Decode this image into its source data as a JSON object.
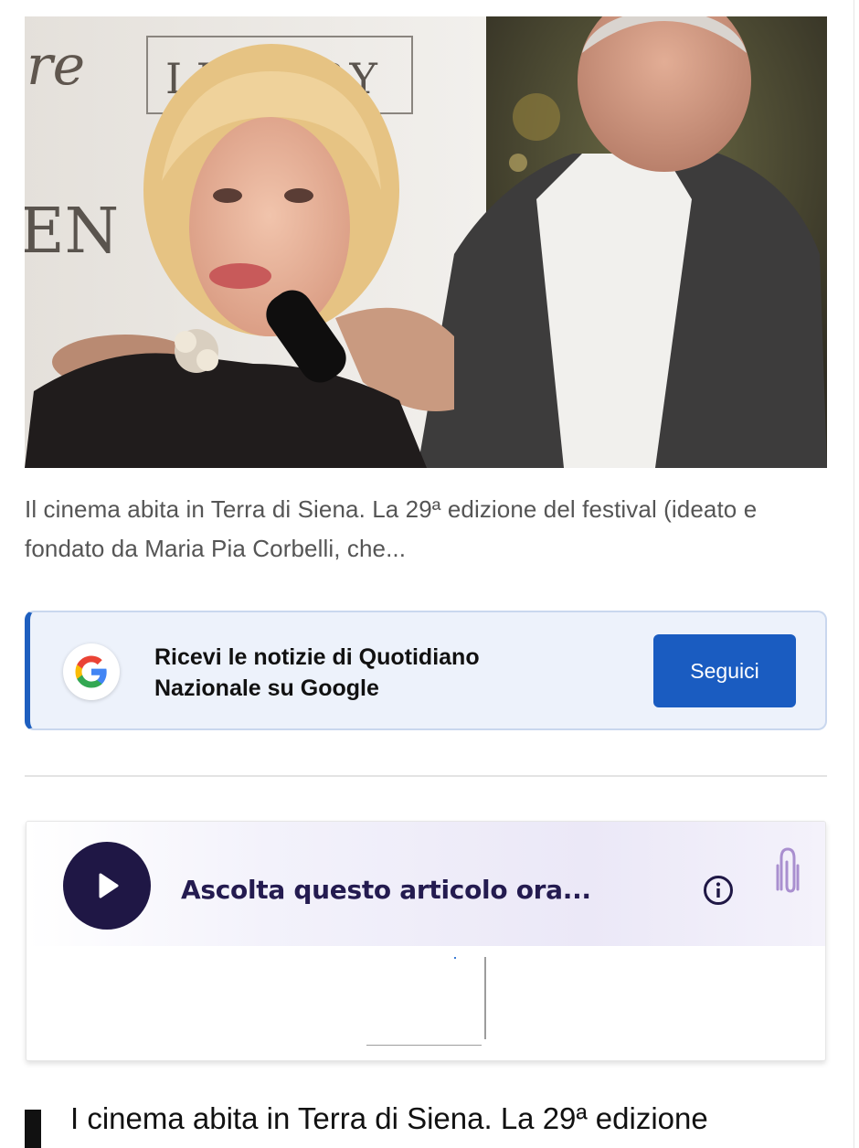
{
  "hero": {
    "image_alt": "Photo of a blonde woman speaking into a microphone next to a man in a grey jacket",
    "backdrop_text_1": "re",
    "backdrop_text_2": "LUXURY",
    "backdrop_text_3": "EN"
  },
  "caption": {
    "text": "Il cinema abita in Terra di Siena. La 29ª edizione del festival (ideato e fondato da Maria Pia Corbelli, che..."
  },
  "google_follow": {
    "icon": "google-g-icon",
    "title": "Ricevi le notizie di Quotidiano Nazionale su Google",
    "button_label": "Seguici",
    "accent_color": "#1e5fbf"
  },
  "audio_player": {
    "prompt": "Ascolta questo articolo ora...",
    "play_icon": "play-icon",
    "info_icon": "info-icon",
    "brand_icon": "paperclip-icon",
    "accent_color": "#1f1745"
  },
  "article": {
    "first_line": "I cinema abita in Terra di Siena. La 29ª edizione"
  }
}
